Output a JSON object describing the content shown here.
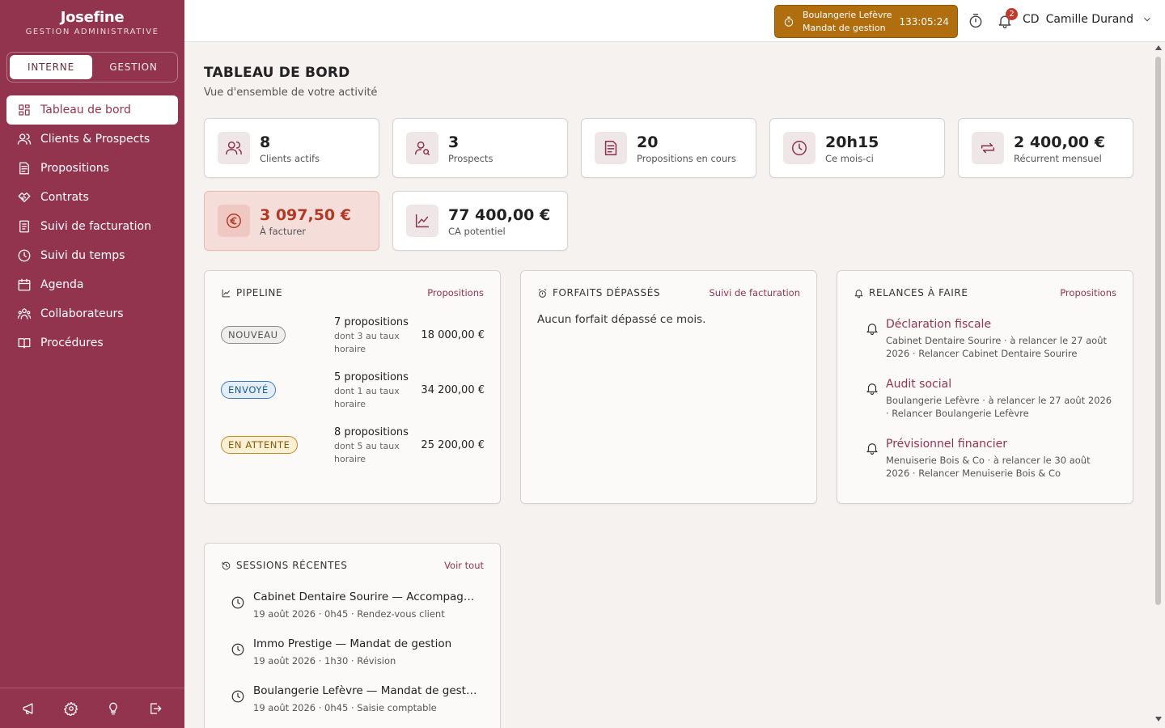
{
  "brand": {
    "name": "Josefine",
    "subtitle": "GESTION ADMINISTRATIVE"
  },
  "mode_switch": {
    "active": "INTERNE",
    "inactive": "GESTION"
  },
  "sidebar": {
    "items": [
      {
        "label": "Tableau de bord",
        "icon": "dashboard-icon",
        "active": true
      },
      {
        "label": "Clients & Prospects",
        "icon": "users-icon"
      },
      {
        "label": "Propositions",
        "icon": "document-icon"
      },
      {
        "label": "Contrats",
        "icon": "handshake-icon"
      },
      {
        "label": "Suivi de facturation",
        "icon": "invoice-icon"
      },
      {
        "label": "Suivi du temps",
        "icon": "clock-icon"
      },
      {
        "label": "Agenda",
        "icon": "calendar-icon"
      },
      {
        "label": "Collaborateurs",
        "icon": "team-icon"
      },
      {
        "label": "Procédures",
        "icon": "book-icon"
      }
    ],
    "footer_icons": [
      "megaphone-icon",
      "gear-icon",
      "lightbulb-icon",
      "logout-icon"
    ]
  },
  "topbar": {
    "timer": {
      "client": "Boulangerie Lefèvre",
      "task": "Mandat de gestion",
      "elapsed": "133:05:24"
    },
    "notifications_count": "2",
    "user": {
      "initials": "CD",
      "name": "Camille Durand"
    }
  },
  "page": {
    "title": "TABLEAU DE BORD",
    "subtitle": "Vue d'ensemble de votre activité"
  },
  "stats": [
    {
      "value": "8",
      "label": "Clients actifs",
      "icon": "users-icon"
    },
    {
      "value": "3",
      "label": "Prospects",
      "icon": "user-search-icon"
    },
    {
      "value": "20",
      "label": "Propositions en cours",
      "icon": "document-icon"
    },
    {
      "value": "20h15",
      "label": "Ce mois-ci",
      "icon": "clock-icon"
    },
    {
      "value": "2 400,00 €",
      "label": "Récurrent mensuel",
      "icon": "repeat-icon"
    },
    {
      "value": "3 097,50 €",
      "label": "À facturer",
      "icon": "euro-icon",
      "highlight": true
    },
    {
      "value": "77 400,00 €",
      "label": "CA potentiel",
      "icon": "chart-line-icon"
    }
  ],
  "pipeline": {
    "title": "PIPELINE",
    "link": "Propositions",
    "rows": [
      {
        "status": "NOUVEAU",
        "count": "7 propositions",
        "note": "dont 3 au taux horaire",
        "amount": "18 000,00 €"
      },
      {
        "status": "ENVOYÉ",
        "count": "5 propositions",
        "note": "dont 1 au taux horaire",
        "amount": "34 200,00 €"
      },
      {
        "status": "EN ATTENTE",
        "count": "8 propositions",
        "note": "dont 5 au taux horaire",
        "amount": "25 200,00 €"
      }
    ]
  },
  "forfaits": {
    "title": "FORFAITS DÉPASSÉS",
    "link": "Suivi de facturation",
    "empty": "Aucun forfait dépassé ce mois."
  },
  "relances": {
    "title": "RELANCES À FAIRE",
    "link": "Propositions",
    "items": [
      {
        "title": "Déclaration fiscale",
        "meta": "Cabinet Dentaire Sourire · à relancer le 27 août 2026 · Relancer Cabinet Dentaire Sourire"
      },
      {
        "title": "Audit social",
        "meta": "Boulangerie Lefèvre · à relancer le 27 août 2026 · Relancer Boulangerie Lefèvre"
      },
      {
        "title": "Prévisionnel financier",
        "meta": "Menuiserie Bois & Co · à relancer le 30 août 2026 · Relancer Menuiserie Bois & Co"
      }
    ]
  },
  "sessions": {
    "title": "SESSIONS RÉCENTES",
    "link": "Voir tout",
    "items": [
      {
        "title": "Cabinet Dentaire Sourire — Accompagne...",
        "meta": "19 août 2026 · 0h45 · Rendez-vous client"
      },
      {
        "title": "Immo Prestige — Mandat de gestion",
        "meta": "19 août 2026 · 1h30 · Révision"
      },
      {
        "title": "Boulangerie Lefèvre — Mandat de gestion",
        "meta": "19 août 2026 · 0h45 · Saisie comptable"
      }
    ]
  },
  "colors": {
    "brand": "#93344e",
    "timer": "#b06e0e",
    "alert": "#b03a26"
  }
}
